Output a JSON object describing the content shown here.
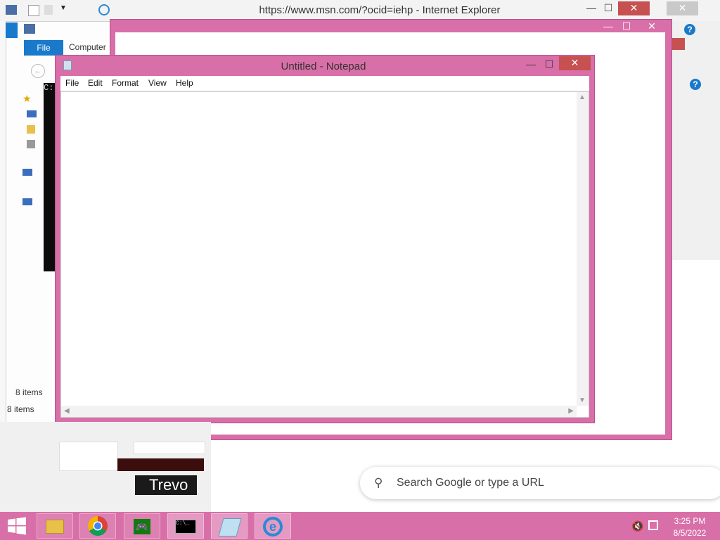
{
  "ie": {
    "title": "https://www.msn.com/?ocid=iehp - Internet Explorer",
    "close": "✕",
    "minimize": "—",
    "maximize": "☐"
  },
  "explorer": {
    "file_tab": "File",
    "computer_tab": "Computer",
    "items_count_1": "8 items",
    "items_count_2": "8 items"
  },
  "cmd": {
    "prompt": "C:"
  },
  "pink_window": {
    "close": "✕",
    "minimize": "—",
    "maximize": "☐"
  },
  "notepad": {
    "title": "Untitled - Notepad",
    "menu": [
      "File",
      "Edit",
      "Format",
      "View",
      "Help"
    ],
    "minimize": "—",
    "maximize": "☐",
    "close": "✕",
    "content": ""
  },
  "google": {
    "search_placeholder": "Search Google or type a URL"
  },
  "tile_text": "Trevo",
  "taskbar": {
    "time": "3:25 PM",
    "date": "8/5/2022",
    "apps": [
      "file-explorer-icon",
      "chrome-icon",
      "xbox-games-icon",
      "command-prompt-icon",
      "notepad-icon",
      "internet-explorer-icon"
    ]
  },
  "colors": {
    "accent": "#d96fa8",
    "close_red": "#c75050",
    "ribbon_blue": "#1979ca"
  }
}
